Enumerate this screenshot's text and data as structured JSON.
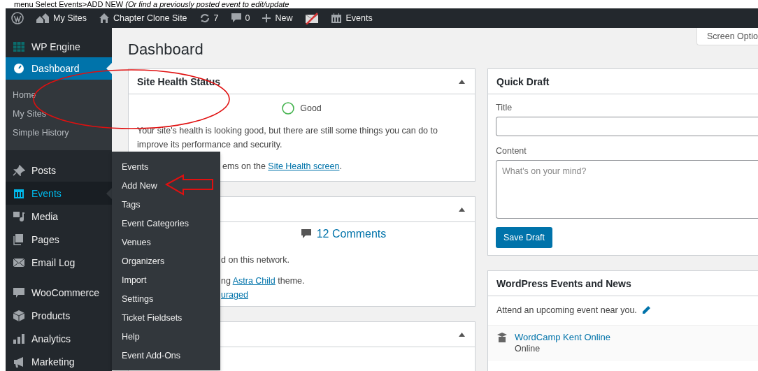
{
  "caption": "menu Select Events>ADD NEW *(Or find a previously posted event to edit/update*",
  "admin_bar": [
    {
      "kind": "logo"
    },
    {
      "kind": "sites",
      "label": "My Sites"
    },
    {
      "kind": "home",
      "label": "Chapter Clone Site"
    },
    {
      "kind": "updates",
      "label": "7"
    },
    {
      "kind": "comments",
      "label": "0"
    },
    {
      "kind": "new",
      "label": "New"
    },
    {
      "kind": "mail"
    },
    {
      "kind": "calendar",
      "label": "Events"
    }
  ],
  "sidebar": {
    "sections": [
      {
        "items": [
          {
            "label": "WP Engine",
            "selected": false,
            "open": false
          },
          {
            "label": "Dashboard",
            "selected": true,
            "open": false,
            "submenu": [
              "Home",
              "My Sites",
              "Simple History"
            ]
          }
        ]
      },
      {
        "items": [
          {
            "label": "Posts",
            "selected": false,
            "open": false
          },
          {
            "label": "Events",
            "selected": false,
            "open": true
          },
          {
            "label": "Media",
            "selected": false,
            "open": false
          },
          {
            "label": "Pages",
            "selected": false,
            "open": false
          },
          {
            "label": "Email Log",
            "selected": false,
            "open": false
          }
        ]
      },
      {
        "items": [
          {
            "label": "WooCommerce",
            "selected": false,
            "open": false
          },
          {
            "label": "Products",
            "selected": false,
            "open": false
          },
          {
            "label": "Analytics",
            "selected": false,
            "open": false
          },
          {
            "label": "Marketing",
            "selected": false,
            "open": false
          }
        ]
      }
    ]
  },
  "flyout": [
    "Events",
    "Add New",
    "Tags",
    "Event Categories",
    "Venues",
    "Organizers",
    "Import",
    "Settings",
    "Ticket Fieldsets",
    "Help",
    "Event Add-Ons"
  ],
  "main": {
    "title": "Dashboard",
    "screen_options": "Screen Optio"
  },
  "site_health": {
    "title": "Site Health Status",
    "status": "Good",
    "text": "Your site's health is looking good, but there are still some things you can do to improve its performance and security.",
    "tail": {
      "before": "ems on the ",
      "link": "Site Health screen",
      "after": "."
    }
  },
  "at_a_glance": {
    "comments": "12 Comments",
    "lines": [
      {
        "before": "d on this network."
      },
      {
        "before": "ng ",
        "link": "Astra Child",
        "after": " theme."
      },
      {
        "link": "uraged"
      }
    ]
  },
  "quick_draft": {
    "title": "Quick Draft",
    "title_label": "Title",
    "content_label": "Content",
    "content_placeholder": "What's on your mind?",
    "button": "Save Draft"
  },
  "events_news": {
    "title": "WordPress Events and News",
    "intro": "Attend an upcoming event near you.",
    "events": [
      {
        "name": "WordCamp Kent Online",
        "place": "Online"
      }
    ]
  }
}
